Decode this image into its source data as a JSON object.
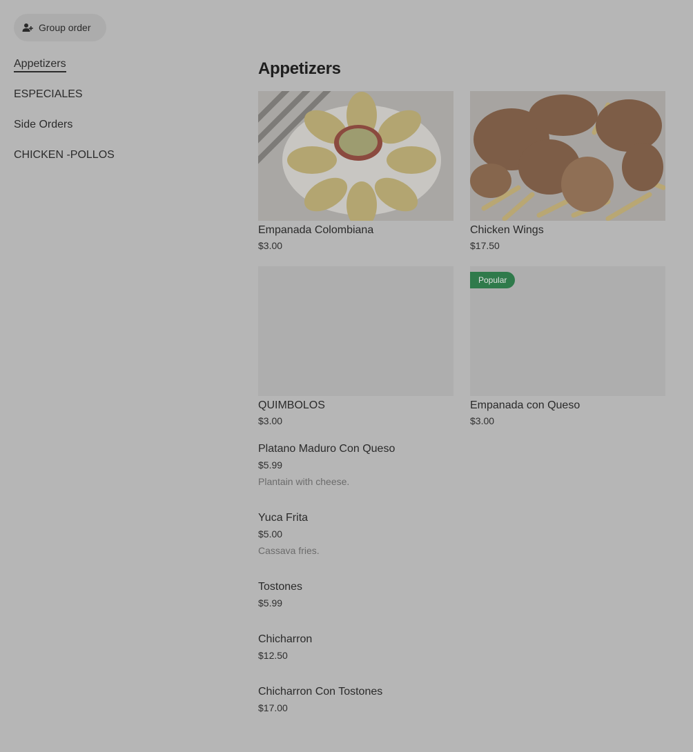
{
  "group_order": {
    "label": "Group order",
    "icon": "add-person-icon"
  },
  "sidebar": {
    "items": [
      {
        "label": "Appetizers",
        "active": true
      },
      {
        "label": "ESPECIALES"
      },
      {
        "label": "Side Orders"
      },
      {
        "label": "CHICKEN -POLLOS"
      }
    ]
  },
  "section": {
    "title": "Appetizers"
  },
  "featured": [
    {
      "name": "Empanada Colombiana",
      "price": "$3.00",
      "image": "empanadas-photo"
    },
    {
      "name": "Chicken Wings",
      "price": "$17.50",
      "image": "chicken-wings-photo"
    },
    {
      "name": "QUIMBOLOS",
      "price": "$3.00",
      "image": "placeholder"
    },
    {
      "name": "Empanada con Queso",
      "price": "$3.00",
      "image": "placeholder",
      "badge": "Popular"
    }
  ],
  "list": [
    {
      "name": "Platano Maduro Con Queso",
      "price": "$5.99",
      "description": "Plantain with cheese."
    },
    {
      "name": "Yuca Frita",
      "price": "$5.00",
      "description": "Cassava fries."
    },
    {
      "name": "Tostones",
      "price": "$5.99"
    },
    {
      "name": "Chicharron",
      "price": "$12.50"
    },
    {
      "name": "Chicharron Con Tostones",
      "price": "$17.00"
    }
  ],
  "colors": {
    "overlay": "#b6b6b6",
    "badge": "#2f7a4b"
  }
}
